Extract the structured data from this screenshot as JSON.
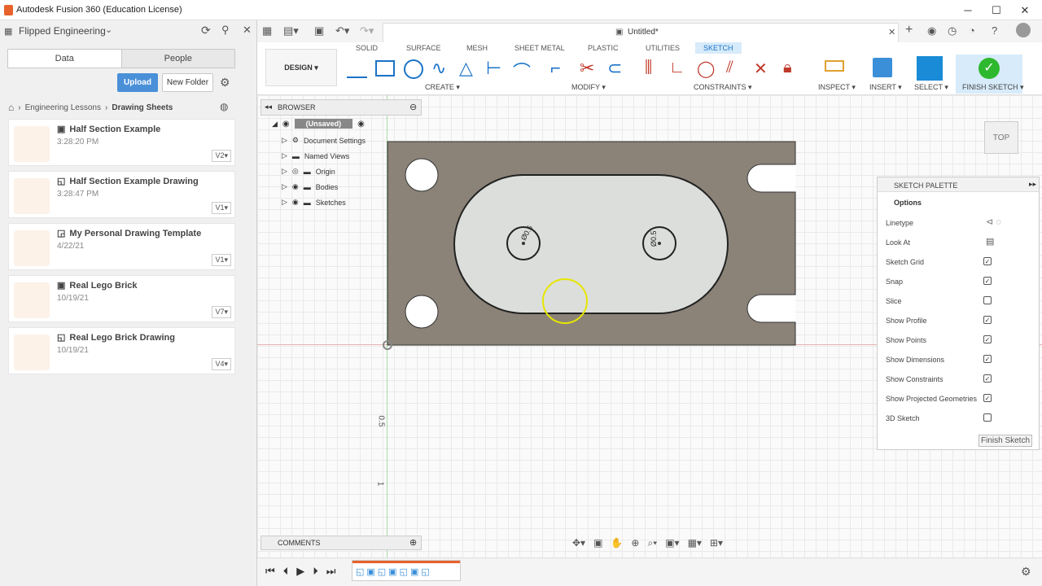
{
  "window": {
    "title": "Autodesk Fusion 360 (Education License)"
  },
  "left": {
    "project": "Flipped Engineering",
    "tab_data": "Data",
    "tab_people": "People",
    "upload": "Upload",
    "new_folder": "New Folder",
    "crumb1": "Engineering Lessons",
    "crumb2": "Drawing Sheets",
    "files": [
      {
        "name": "Half Section Example",
        "date": "3:28:20 PM",
        "ver": "V2▾"
      },
      {
        "name": "Half Section Example Drawing",
        "date": "3:28:47 PM",
        "ver": "V1▾"
      },
      {
        "name": "My Personal Drawing Template",
        "date": "4/22/21",
        "ver": "V1▾"
      },
      {
        "name": "Real Lego Brick",
        "date": "10/19/21",
        "ver": "V7▾"
      },
      {
        "name": "Real Lego Brick Drawing",
        "date": "10/19/21",
        "ver": "V4▾"
      }
    ]
  },
  "doc": {
    "tab": "Untitled*"
  },
  "ribbon": {
    "design": "DESIGN ▾",
    "tabs": [
      "SOLID",
      "SURFACE",
      "MESH",
      "SHEET METAL",
      "PLASTIC",
      "UTILITIES",
      "SKETCH"
    ],
    "groups": {
      "create": "CREATE ▾",
      "modify": "MODIFY ▾",
      "constraints": "CONSTRAINTS ▾",
      "inspect": "INSPECT ▾",
      "insert": "INSERT ▾",
      "select": "SELECT ▾",
      "finish": "FINISH SKETCH ▾"
    }
  },
  "browser": {
    "title": "BROWSER",
    "root": "(Unsaved)",
    "items": [
      "Document Settings",
      "Named Views",
      "Origin",
      "Bodies",
      "Sketches"
    ]
  },
  "palette": {
    "title": "SKETCH PALETTE",
    "section": "Options",
    "rows": [
      {
        "label": "Linetype",
        "type": "icon"
      },
      {
        "label": "Look At",
        "type": "icon"
      },
      {
        "label": "Sketch Grid",
        "checked": true
      },
      {
        "label": "Snap",
        "checked": true
      },
      {
        "label": "Slice",
        "checked": false
      },
      {
        "label": "Show Profile",
        "checked": true
      },
      {
        "label": "Show Points",
        "checked": true
      },
      {
        "label": "Show Dimensions",
        "checked": true
      },
      {
        "label": "Show Constraints",
        "checked": true
      },
      {
        "label": "Show Projected Geometries",
        "checked": true
      },
      {
        "label": "3D Sketch",
        "checked": false
      }
    ],
    "finish": "Finish Sketch"
  },
  "viewcube": "TOP",
  "dims": {
    "d1": "Ø0.5",
    "d2": "Ø0.5"
  },
  "axis": {
    "y1": "0.5",
    "y2": "1"
  },
  "comments": "COMMENTS"
}
